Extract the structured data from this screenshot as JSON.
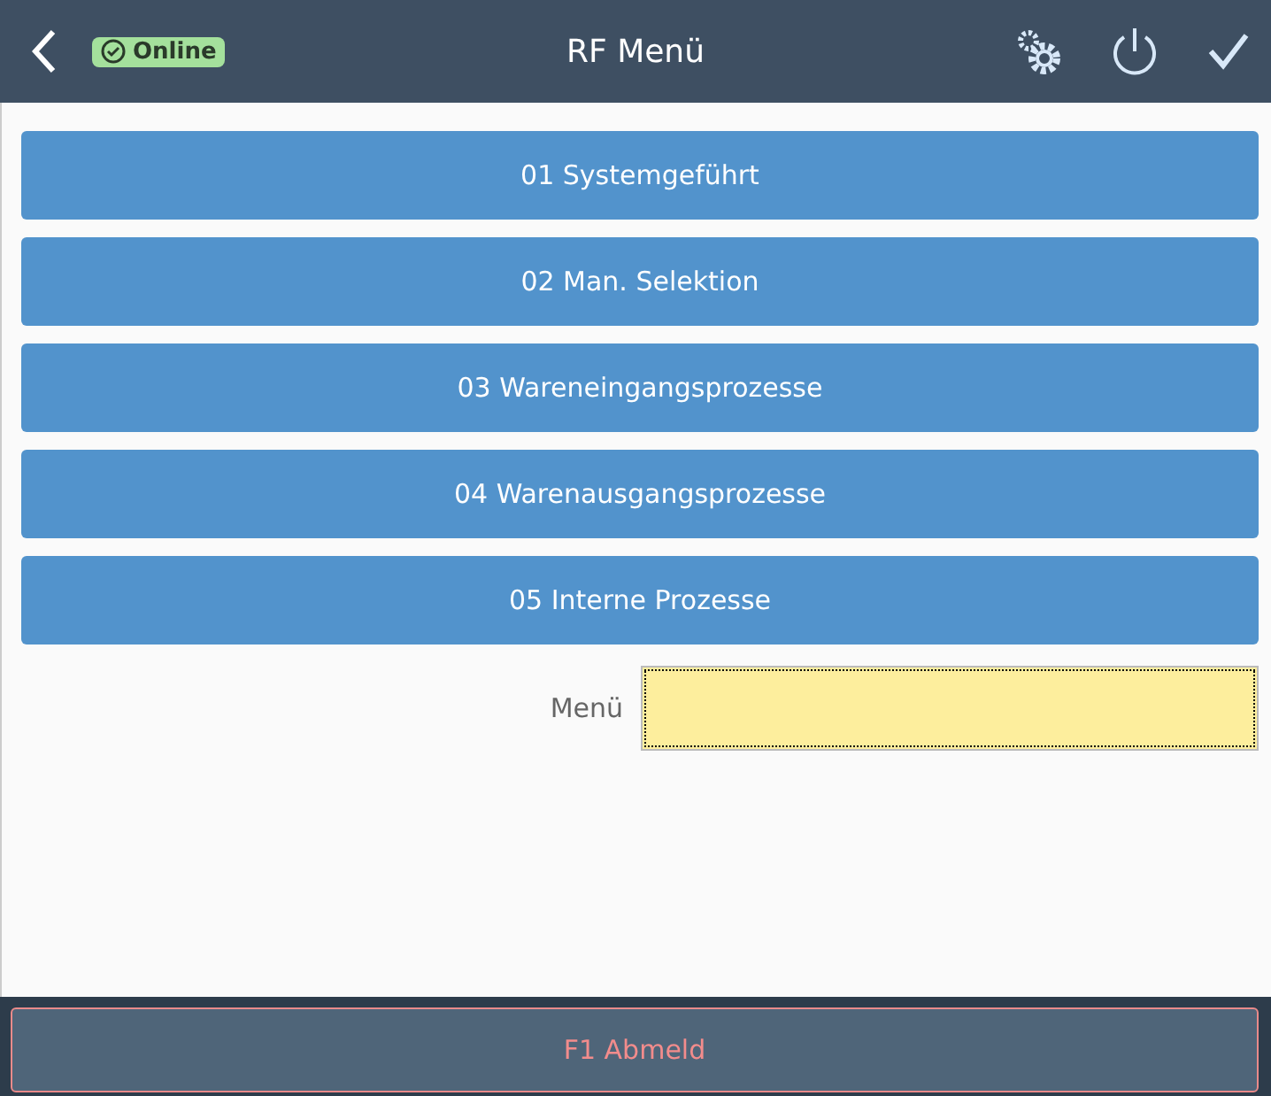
{
  "header": {
    "title": "RF Menü",
    "status": "Online"
  },
  "menu_buttons": [
    "01 Systemgeführt",
    "02 Man. Selektion",
    "03 Wareneingangsprozesse",
    "04 Warenausgangsprozesse",
    "05 Interne Prozesse"
  ],
  "field": {
    "label": "Menü"
  },
  "footer": {
    "button": "F1 Abmeld"
  }
}
